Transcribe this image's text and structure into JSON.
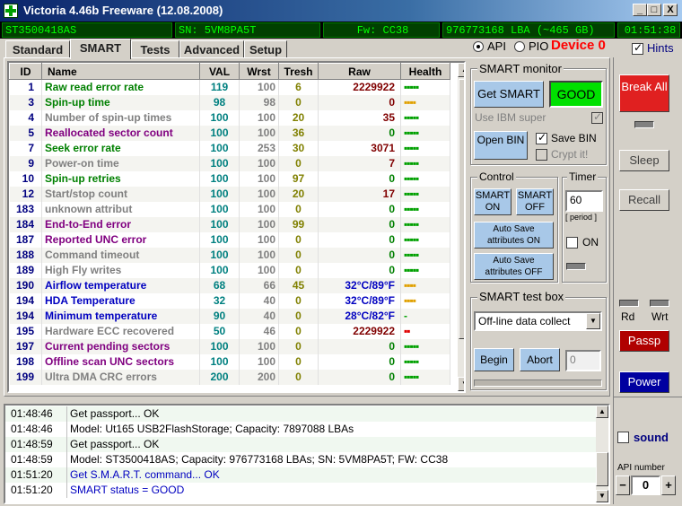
{
  "window": {
    "title": "Victoria 4.46b Freeware (12.08.2008)",
    "min_label": "_",
    "max_label": "□",
    "close_label": "X"
  },
  "info": {
    "model": "ST3500418AS",
    "serial": "SN: 5VM8PA5T",
    "firmware": "Fw: CC38",
    "lba": "976773168 LBA (~465 GB)",
    "clock": "01:51:38"
  },
  "tabs": [
    "Standard",
    "SMART",
    "Tests",
    "Advanced",
    "Setup"
  ],
  "mode": {
    "api_label": "API",
    "pio_label": "PIO",
    "device_label": "Device 0",
    "hints_label": "Hints"
  },
  "table": {
    "headers": [
      "ID",
      "Name",
      "VAL",
      "Wrst",
      "Tresh",
      "Raw",
      "Health"
    ],
    "rows": [
      {
        "id": "1",
        "name": "Raw read error rate",
        "val": "119",
        "wrst": "100",
        "tresh": "6",
        "raw": "2229922",
        "health": "▪▪▪▪▪",
        "name_color": "#008000",
        "raw_color": "#800000",
        "health_class": "h-good"
      },
      {
        "id": "3",
        "name": "Spin-up time",
        "val": "98",
        "wrst": "98",
        "tresh": "0",
        "raw": "0",
        "health": "▪▪▪▪",
        "name_color": "#008000",
        "raw_color": "#800000",
        "health_class": "h-warn"
      },
      {
        "id": "4",
        "name": "Number of spin-up times",
        "val": "100",
        "wrst": "100",
        "tresh": "20",
        "raw": "35",
        "health": "▪▪▪▪▪",
        "name_color": "#808080",
        "raw_color": "#800000",
        "health_class": "h-good"
      },
      {
        "id": "5",
        "name": "Reallocated sector count",
        "val": "100",
        "wrst": "100",
        "tresh": "36",
        "raw": "0",
        "health": "▪▪▪▪▪",
        "name_color": "#800080",
        "raw_color": "#008000",
        "health_class": "h-good"
      },
      {
        "id": "7",
        "name": "Seek error rate",
        "val": "100",
        "wrst": "253",
        "tresh": "30",
        "raw": "3071",
        "health": "▪▪▪▪▪",
        "name_color": "#008000",
        "raw_color": "#800000",
        "health_class": "h-good"
      },
      {
        "id": "9",
        "name": "Power-on time",
        "val": "100",
        "wrst": "100",
        "tresh": "0",
        "raw": "7",
        "health": "▪▪▪▪▪",
        "name_color": "#808080",
        "raw_color": "#800000",
        "health_class": "h-good"
      },
      {
        "id": "10",
        "name": "Spin-up retries",
        "val": "100",
        "wrst": "100",
        "tresh": "97",
        "raw": "0",
        "health": "▪▪▪▪▪",
        "name_color": "#008000",
        "raw_color": "#008000",
        "health_class": "h-good"
      },
      {
        "id": "12",
        "name": "Start/stop count",
        "val": "100",
        "wrst": "100",
        "tresh": "20",
        "raw": "17",
        "health": "▪▪▪▪▪",
        "name_color": "#808080",
        "raw_color": "#800000",
        "health_class": "h-good"
      },
      {
        "id": "183",
        "name": "unknown attribut",
        "val": "100",
        "wrst": "100",
        "tresh": "0",
        "raw": "0",
        "health": "▪▪▪▪▪",
        "name_color": "#808080",
        "raw_color": "#008000",
        "health_class": "h-good"
      },
      {
        "id": "184",
        "name": "End-to-End error",
        "val": "100",
        "wrst": "100",
        "tresh": "99",
        "raw": "0",
        "health": "▪▪▪▪▪",
        "name_color": "#800080",
        "raw_color": "#008000",
        "health_class": "h-good"
      },
      {
        "id": "187",
        "name": "Reported UNC error",
        "val": "100",
        "wrst": "100",
        "tresh": "0",
        "raw": "0",
        "health": "▪▪▪▪▪",
        "name_color": "#800080",
        "raw_color": "#008000",
        "health_class": "h-good"
      },
      {
        "id": "188",
        "name": "Command timeout",
        "val": "100",
        "wrst": "100",
        "tresh": "0",
        "raw": "0",
        "health": "▪▪▪▪▪",
        "name_color": "#808080",
        "raw_color": "#008000",
        "health_class": "h-good"
      },
      {
        "id": "189",
        "name": "High Fly writes",
        "val": "100",
        "wrst": "100",
        "tresh": "0",
        "raw": "0",
        "health": "▪▪▪▪▪",
        "name_color": "#808080",
        "raw_color": "#008000",
        "health_class": "h-good"
      },
      {
        "id": "190",
        "name": "Airflow temperature",
        "val": "68",
        "wrst": "66",
        "tresh": "45",
        "raw": "32°C/89°F",
        "health": "▪▪▪▪",
        "name_color": "#0000c0",
        "raw_color": "#0000c0",
        "health_class": "h-warn"
      },
      {
        "id": "194",
        "name": "HDA Temperature",
        "val": "32",
        "wrst": "40",
        "tresh": "0",
        "raw": "32°C/89°F",
        "health": "▪▪▪▪",
        "name_color": "#0000c0",
        "raw_color": "#0000c0",
        "health_class": "h-warn"
      },
      {
        "id": "194",
        "name": "Minimum temperature",
        "val": "90",
        "wrst": "40",
        "tresh": "0",
        "raw": "28°C/82°F",
        "health": "-",
        "name_color": "#0000c0",
        "raw_color": "#0000c0",
        "health_class": "h-zero"
      },
      {
        "id": "195",
        "name": "Hardware ECC recovered",
        "val": "50",
        "wrst": "46",
        "tresh": "0",
        "raw": "2229922",
        "health": "▪▪",
        "name_color": "#808080",
        "raw_color": "#800000",
        "health_class": "h-bad"
      },
      {
        "id": "197",
        "name": "Current pending sectors",
        "val": "100",
        "wrst": "100",
        "tresh": "0",
        "raw": "0",
        "health": "▪▪▪▪▪",
        "name_color": "#800080",
        "raw_color": "#008000",
        "health_class": "h-good"
      },
      {
        "id": "198",
        "name": "Offline scan UNC sectors",
        "val": "100",
        "wrst": "100",
        "tresh": "0",
        "raw": "0",
        "health": "▪▪▪▪▪",
        "name_color": "#800080",
        "raw_color": "#008000",
        "health_class": "h-good"
      },
      {
        "id": "199",
        "name": "Ultra DMA CRC errors",
        "val": "200",
        "wrst": "200",
        "tresh": "0",
        "raw": "0",
        "health": "▪▪▪▪▪",
        "name_color": "#808080",
        "raw_color": "#008000",
        "health_class": "h-good"
      }
    ]
  },
  "smart_monitor": {
    "title": "SMART monitor",
    "get_smart": "Get SMART",
    "status": "GOOD",
    "use_ibm": "Use IBM super",
    "open_bin": "Open BIN",
    "save_bin": "Save BIN",
    "crypt_it": "Crypt it!"
  },
  "control": {
    "title": "Control",
    "smart_on": "SMART ON",
    "smart_off": "SMART OFF",
    "autosave_on": "Auto Save attributes ON",
    "autosave_off": "Auto Save attributes OFF"
  },
  "timer": {
    "title": "Timer",
    "value": "60",
    "period": "[ period ]",
    "on_label": "ON"
  },
  "testbox": {
    "title": "SMART test box",
    "selected": "Off-line data collect",
    "begin": "Begin",
    "abort": "Abort",
    "value": "0"
  },
  "right_panel": {
    "break_all": "Break All",
    "sleep": "Sleep",
    "recall": "Recall",
    "rd": "Rd",
    "wrt": "Wrt",
    "passp": "Passp",
    "power": "Power",
    "sound": "sound",
    "api_number_label": "API number",
    "api_number": "0",
    "minus": "−",
    "plus": "+"
  },
  "log": [
    {
      "time": "01:48:46",
      "msg": "Get passport... OK",
      "color": "#000000"
    },
    {
      "time": "01:48:46",
      "msg": "Model: Ut165   USB2FlashStorage; Capacity: 7897088 LBAs",
      "color": "#000000"
    },
    {
      "time": "01:48:59",
      "msg": "Get passport... OK",
      "color": "#000000"
    },
    {
      "time": "01:48:59",
      "msg": "Model: ST3500418AS; Capacity: 976773168 LBAs; SN: 5VM8PA5T; FW: CC38",
      "color": "#000000"
    },
    {
      "time": "01:51:20",
      "msg": "Get S.M.A.R.T. command... OK",
      "color": "#0000c0"
    },
    {
      "time": "01:51:20",
      "msg": "SMART status = GOOD",
      "color": "#0000c0"
    }
  ],
  "colors": {
    "title_bar": "#0a246a",
    "info_bg": "#004000",
    "info_text": "#00ff00",
    "good_status": "#00e000",
    "break_red": "#e02020",
    "passp_red": "#b00000",
    "power_blue": "#0000a0",
    "device_red": "#ff0000"
  }
}
